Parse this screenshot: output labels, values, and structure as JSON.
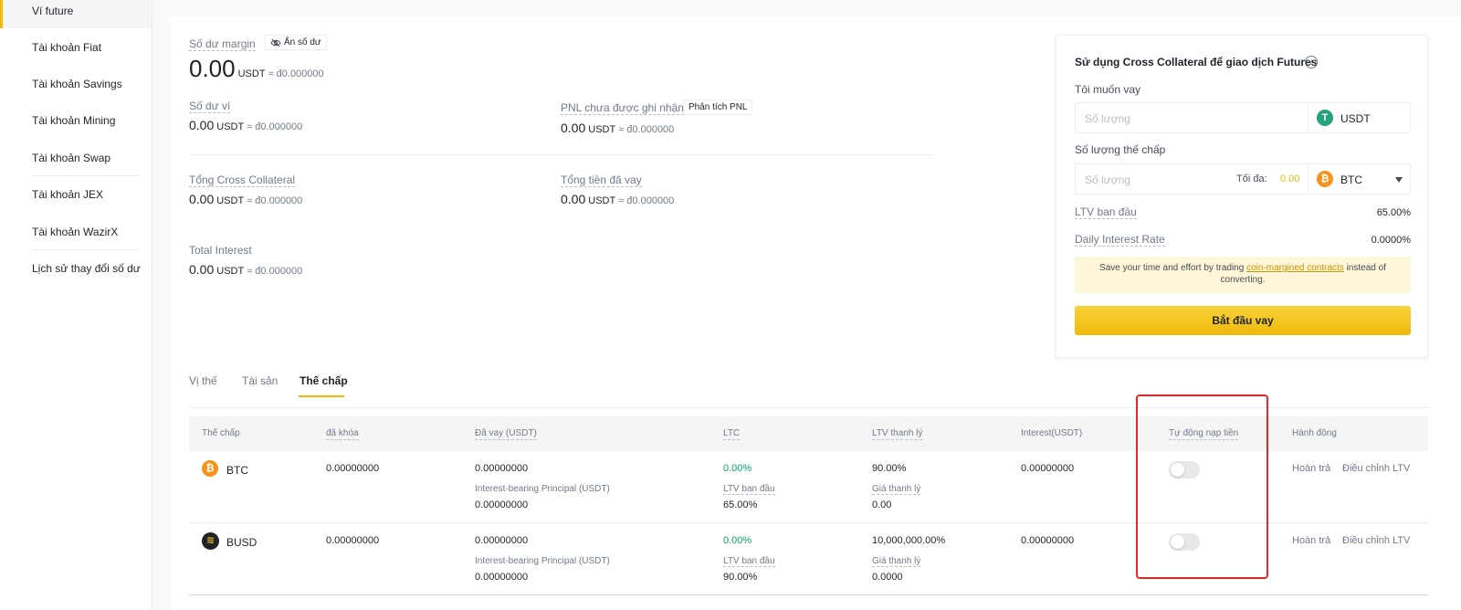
{
  "sidebar": {
    "items": [
      {
        "label": "Ví future",
        "active": true
      },
      {
        "label": "Tài khoản Fiat"
      },
      {
        "label": "Tài khoản Savings"
      },
      {
        "label": "Tài khoản Mining"
      },
      {
        "label": "Tài khoản Swap"
      },
      {
        "label": "Tài khoản JEX"
      },
      {
        "label": "Tài khoản WazirX"
      },
      {
        "label": "Lịch sử thay đổi số dư"
      }
    ]
  },
  "summary": {
    "margin_balance_label": "Số dư margin",
    "hide_balance_label": "Ẩn số dư",
    "margin_balance_value": "0.00",
    "unit": "USDT",
    "fiat_approx": "≈ đ0.000000",
    "wallet_balance_label": "Số dư ví",
    "wallet_balance_value": "0.00",
    "unrealized_pnl_label": "PNL chưa được ghi nhận",
    "pnl_analysis_label": "Phân tích PNL",
    "unrealized_pnl_value": "0.00",
    "total_cross_collateral_label": "Tổng Cross Collateral",
    "total_cross_collateral_value": "0.00",
    "total_borrowed_label": "Tổng tiền đã vay",
    "total_borrowed_value": "0.00",
    "total_interest_label": "Total Interest",
    "total_interest_value": "0.00"
  },
  "borrow_card": {
    "title": "Sử dụng Cross Collateral để giao dịch Futures",
    "want_borrow_label": "Tôi muốn vay",
    "amount_placeholder": "Số lượng",
    "borrow_coin": "USDT",
    "collateral_amount_label": "Số lượng thế chấp",
    "max_label": "Tối đa:",
    "max_value": "0.00",
    "collateral_coin": "BTC",
    "initial_ltv_label": "LTV ban đầu",
    "initial_ltv_value": "65.00%",
    "daily_interest_label": "Daily Interest Rate",
    "daily_interest_value": "0.0000%",
    "notice_before": "Save your time and effort by trading",
    "notice_link": "coin-margined contracts",
    "notice_after": "instead of converting.",
    "cta_label": "Bắt đầu vay",
    "colors": {
      "accent": "#f0b90b",
      "usdt": "#26a17b",
      "btc": "#f7931a"
    }
  },
  "tabs": [
    {
      "label": "Vị thế"
    },
    {
      "label": "Tài sản"
    },
    {
      "label": "Thế chấp",
      "active": true
    }
  ],
  "table": {
    "headers": {
      "collateral": "Thế chấp",
      "locked": "đã khóa",
      "borrowed": "Đã vay (USDT)",
      "ltc": "LTC",
      "liq_ltv": "LTV thanh lý",
      "interest": "Interest(USDT)",
      "auto_topup": "Tự động nạp tiền",
      "action": "Hành động"
    },
    "rows": [
      {
        "coin": "BTC",
        "locked": "0.00000000",
        "borrowed": "0.00000000",
        "principal_label": "Interest-bearing Principal (USDT)",
        "principal": "0.00000000",
        "ltc": "0.00%",
        "initial_ltv_label": "LTV ban đầu",
        "initial_ltv": "65.00%",
        "liq_ltv": "90.00%",
        "liq_price_label": "Giá thanh lý",
        "liq_price": "0.00",
        "interest": "0.00000000",
        "auto_topup": false,
        "repay": "Hoàn trả",
        "adjust": "Điều chỉnh LTV"
      },
      {
        "coin": "BUSD",
        "locked": "0.00000000",
        "borrowed": "0.00000000",
        "principal_label": "Interest-bearing Principal (USDT)",
        "principal": "0.00000000",
        "ltc": "0.00%",
        "initial_ltv_label": "LTV ban đầu",
        "initial_ltv": "90.00%",
        "liq_ltv": "10,000,000.00%",
        "liq_price_label": "Giá thanh lý",
        "liq_price": "0.0000",
        "interest": "0.00000000",
        "auto_topup": false,
        "repay": "Hoàn trả",
        "adjust": "Điều chỉnh LTV"
      }
    ]
  }
}
